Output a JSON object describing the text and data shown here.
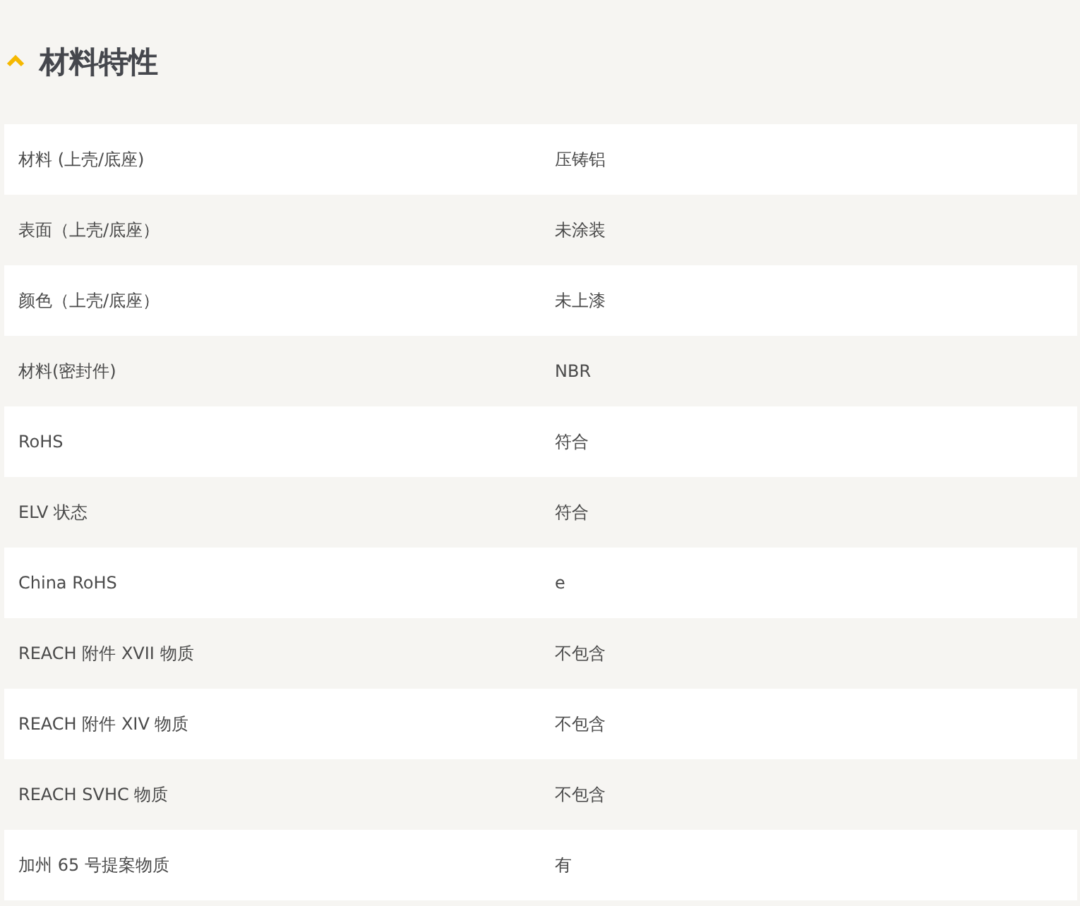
{
  "section": {
    "title": "材料特性",
    "expanded": true,
    "rows": [
      {
        "label": "材料 (上壳/底座)",
        "value": "压铸铝"
      },
      {
        "label": "表面（上壳/底座）",
        "value": "未涂装"
      },
      {
        "label": "颜色（上壳/底座）",
        "value": "未上漆"
      },
      {
        "label": "材料(密封件)",
        "value": "NBR"
      },
      {
        "label": "RoHS",
        "value": "符合"
      },
      {
        "label": "ELV 状态",
        "value": "符合"
      },
      {
        "label": "China RoHS",
        "value": "e"
      },
      {
        "label": "REACH 附件 XVII 物质",
        "value": "不包含"
      },
      {
        "label": "REACH 附件 XIV 物质",
        "value": "不包含"
      },
      {
        "label": "REACH SVHC 物质",
        "value": "不包含"
      },
      {
        "label": "加州 65 号提案物质",
        "value": "有"
      }
    ]
  }
}
